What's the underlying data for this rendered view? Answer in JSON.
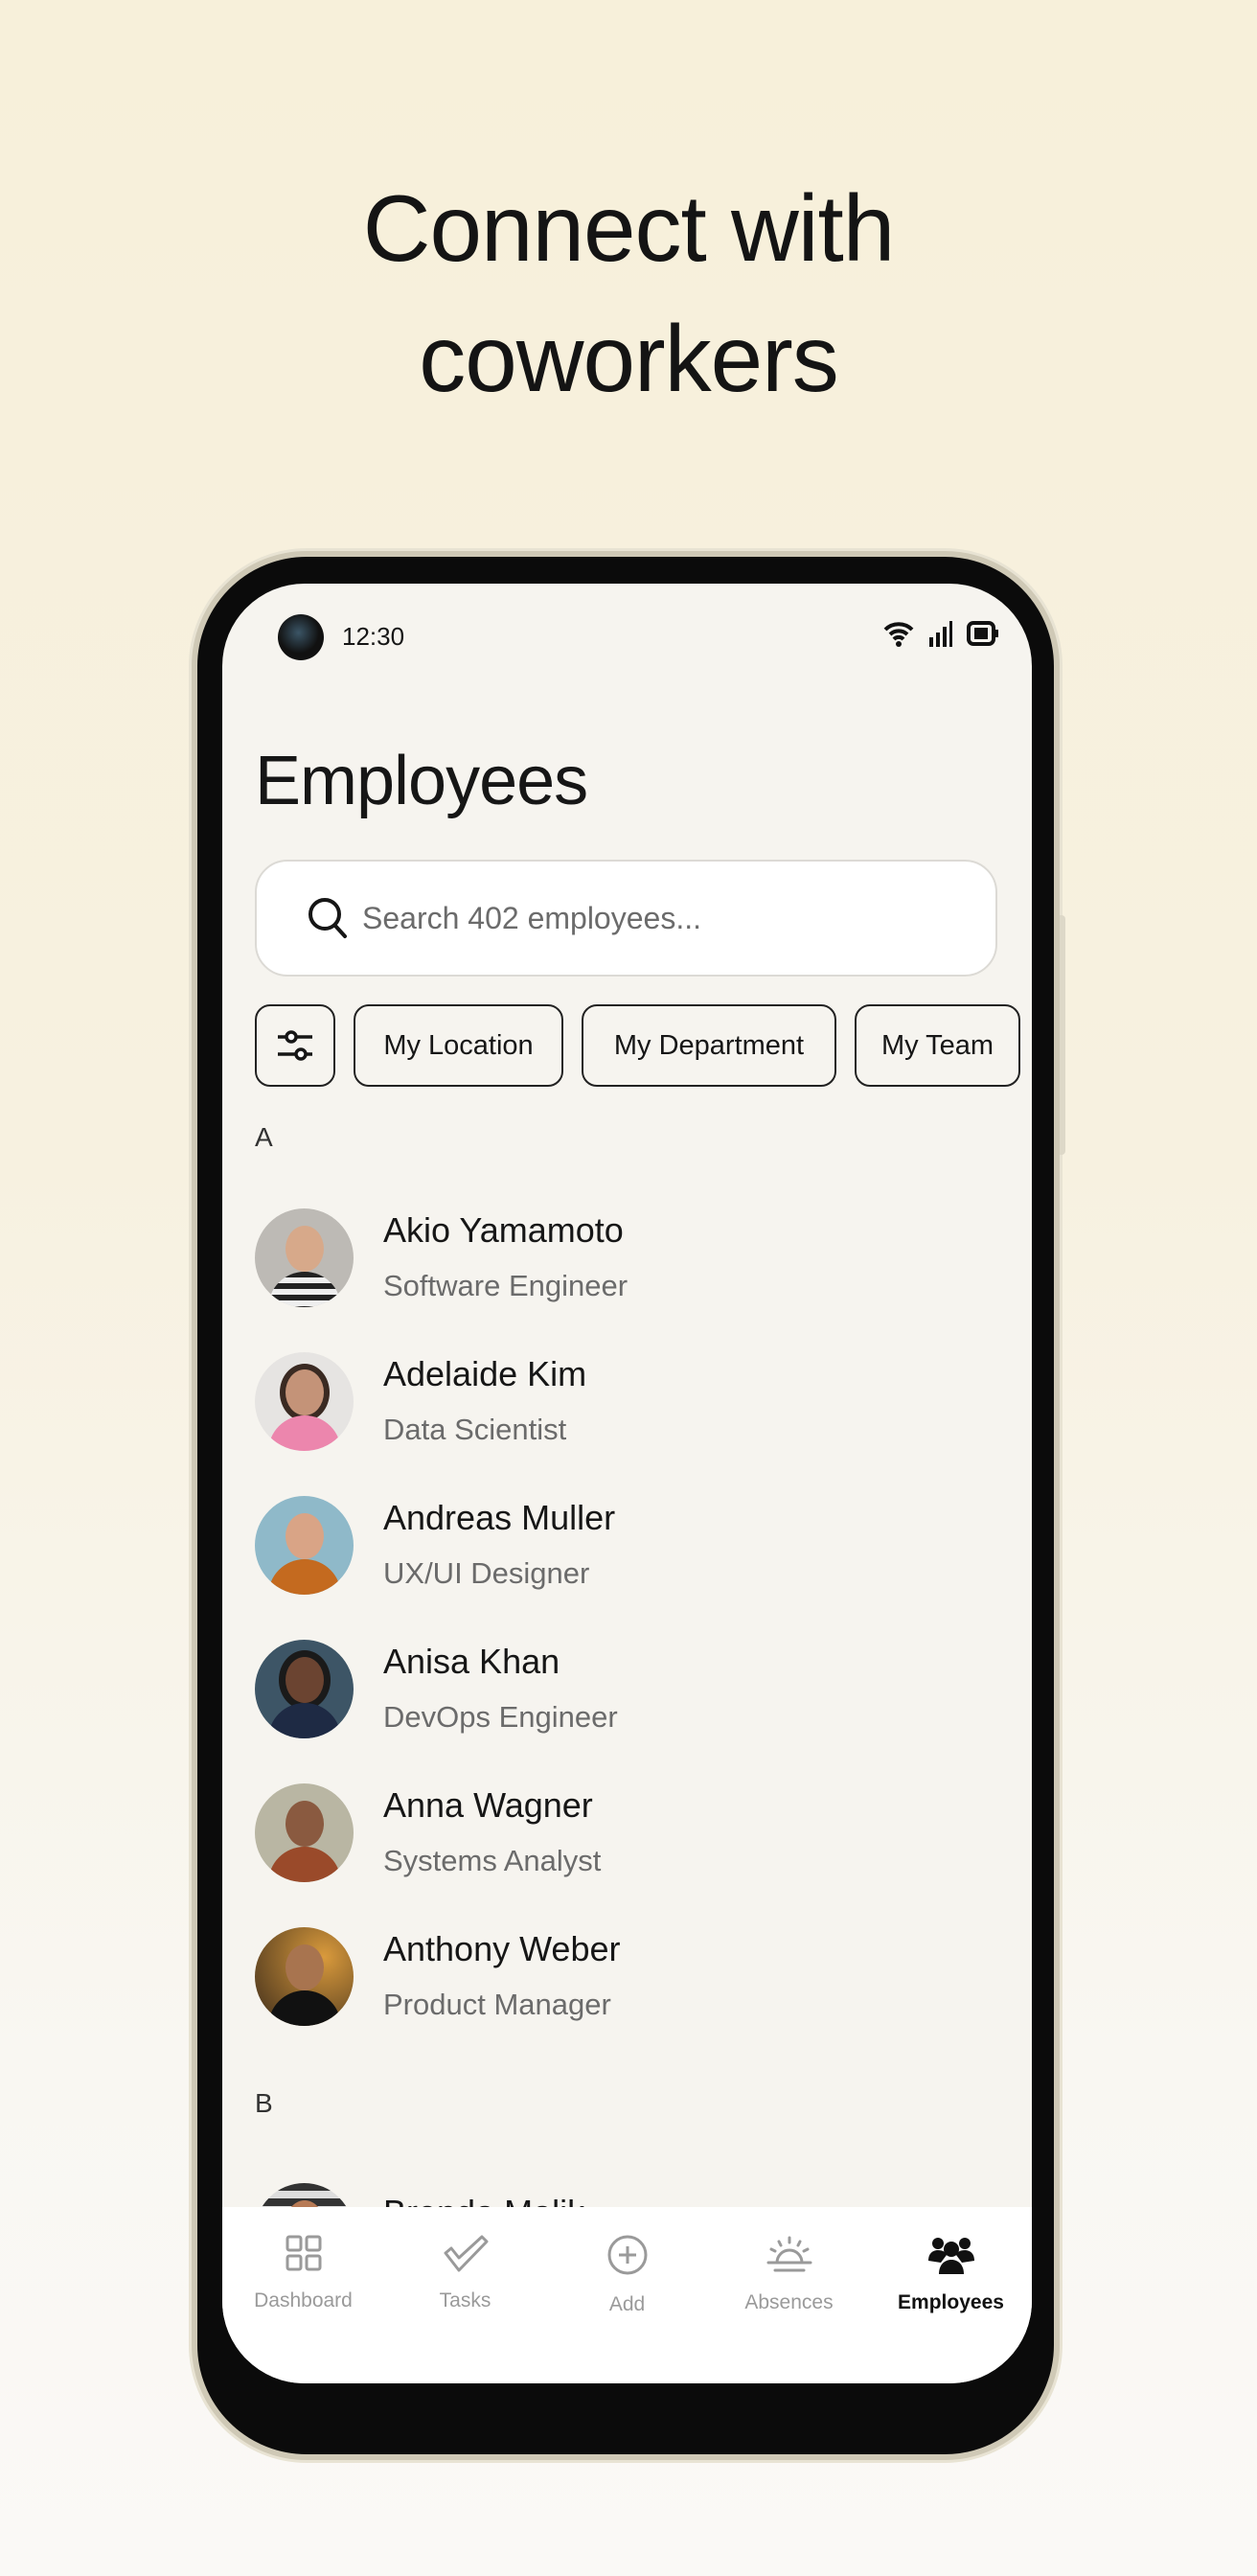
{
  "headline": {
    "line1": "Connect with",
    "line2": "coworkers"
  },
  "status_bar": {
    "time": "12:30",
    "icons": [
      "wifi-icon",
      "signal-icon",
      "battery-icon"
    ]
  },
  "page_title": "Employees",
  "search": {
    "placeholder": "Search 402 employees..."
  },
  "filters": {
    "icon": "sliders-icon",
    "chips": [
      "My Location",
      "My Department",
      "My Team"
    ]
  },
  "sections": [
    {
      "letter": "A",
      "employees": [
        {
          "name": "Akio Yamamoto",
          "role": "Software Engineer"
        },
        {
          "name": "Adelaide Kim",
          "role": "Data Scientist"
        },
        {
          "name": "Andreas Muller",
          "role": "UX/UI Designer"
        },
        {
          "name": "Anisa Khan",
          "role": "DevOps Engineer"
        },
        {
          "name": "Anna Wagner",
          "role": "Systems Analyst"
        },
        {
          "name": "Anthony Weber",
          "role": "Product Manager"
        }
      ]
    },
    {
      "letter": "B",
      "employees": [
        {
          "name": "Brenda Malik"
        }
      ]
    }
  ],
  "nav": {
    "items": [
      {
        "label": "Dashboard",
        "icon": "grid-icon"
      },
      {
        "label": "Tasks",
        "icon": "check-icon"
      },
      {
        "label": "Add",
        "icon": "plus-circle-icon"
      },
      {
        "label": "Absences",
        "icon": "sunrise-icon"
      },
      {
        "label": "Employees",
        "icon": "people-icon",
        "active": true
      }
    ]
  },
  "colors": {
    "background": "#f7f0da",
    "screen": "#f6f4ef",
    "text": "#161616",
    "muted": "#6b6b6b",
    "nav_inactive": "#9a9a9a"
  }
}
